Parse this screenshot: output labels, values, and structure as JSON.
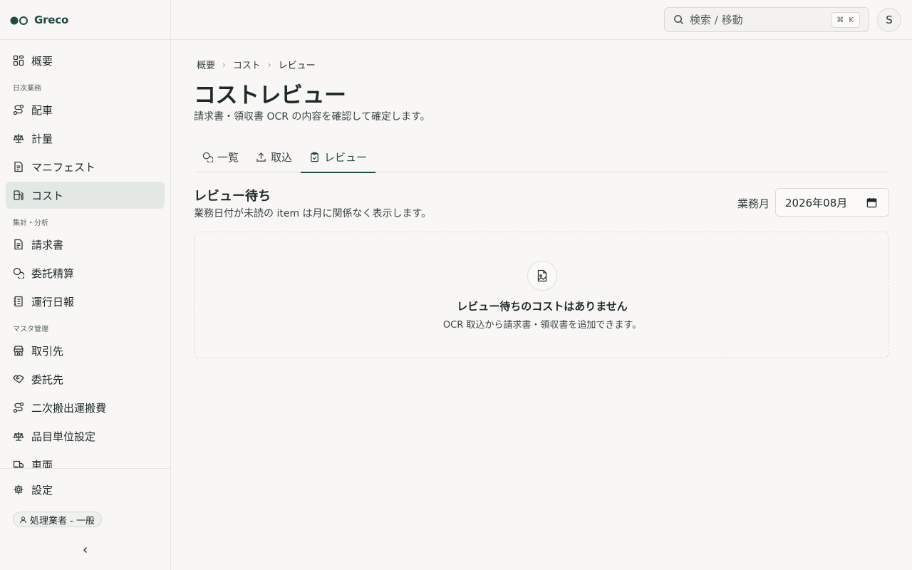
{
  "brand": {
    "name": "Greco"
  },
  "sidebar": {
    "top_item": {
      "label": "概要",
      "icon": "dashboard-icon"
    },
    "sections": [
      {
        "label": "日次業務",
        "items": [
          {
            "label": "配車",
            "icon": "route-icon"
          },
          {
            "label": "計量",
            "icon": "scale-icon"
          },
          {
            "label": "マニフェスト",
            "icon": "document-icon"
          },
          {
            "label": "コスト",
            "icon": "fuel-icon",
            "active": true
          }
        ]
      },
      {
        "label": "集計・分析",
        "items": [
          {
            "label": "請求書",
            "icon": "document-icon"
          },
          {
            "label": "委託精算",
            "icon": "coins-icon"
          },
          {
            "label": "運行日報",
            "icon": "logbook-icon"
          }
        ]
      },
      {
        "label": "マスタ管理",
        "items": [
          {
            "label": "取引先",
            "icon": "store-icon"
          },
          {
            "label": "委託先",
            "icon": "handshake-icon"
          },
          {
            "label": "二次搬出運搬費",
            "icon": "route-icon"
          },
          {
            "label": "品目単位設定",
            "icon": "scale-icon"
          },
          {
            "label": "車両",
            "icon": "truck-icon"
          }
        ]
      }
    ],
    "footer": {
      "settings_label": "設定",
      "role_label": "処理業者 - 一般"
    }
  },
  "topbar": {
    "search_placeholder": "検索 / 移動",
    "shortcut": "⌘ K",
    "avatar_initial": "S"
  },
  "breadcrumb": [
    "概要",
    "コスト",
    "レビュー"
  ],
  "page": {
    "title": "コストレビュー",
    "description": "請求書・領収書 OCR の内容を確認して確定します。"
  },
  "tabs": [
    {
      "label": "一覧",
      "icon": "coins-icon"
    },
    {
      "label": "取込",
      "icon": "upload-icon"
    },
    {
      "label": "レビュー",
      "icon": "clipboard-check-icon",
      "active": true
    }
  ],
  "review": {
    "title": "レビュー待ち",
    "description": "業務日付が未読の item は月に関係なく表示します。",
    "month_label": "業務月",
    "month_value": "2026年08月",
    "empty_title": "レビュー待ちのコストはありません",
    "empty_description": "OCR 取込から請求書・領収書を追加できます。"
  },
  "colors": {
    "accent": "#1d4b43",
    "background": "#f8f7f5",
    "active_nav": "#e4e8e5"
  }
}
